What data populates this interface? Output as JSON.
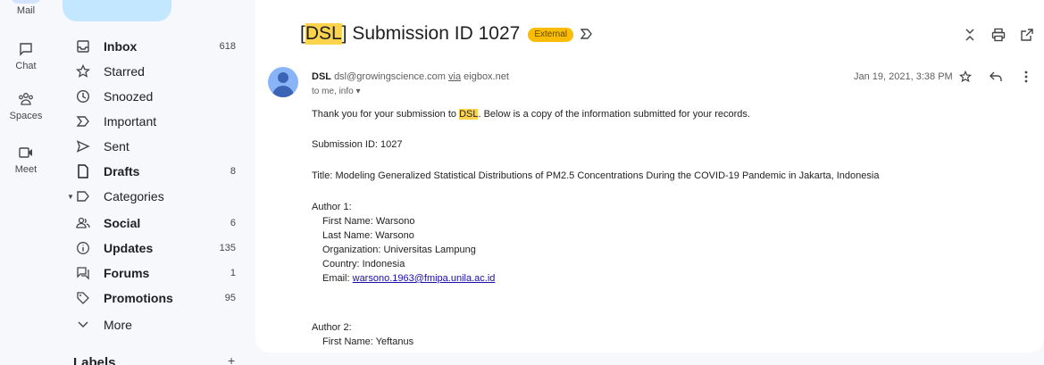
{
  "rail": {
    "mail": "Mail",
    "chat": "Chat",
    "spaces": "Spaces",
    "meet": "Meet"
  },
  "nav": {
    "inbox": {
      "label": "Inbox",
      "count": "618"
    },
    "starred": {
      "label": "Starred"
    },
    "snoozed": {
      "label": "Snoozed"
    },
    "important": {
      "label": "Important"
    },
    "sent": {
      "label": "Sent"
    },
    "drafts": {
      "label": "Drafts",
      "count": "8"
    },
    "categories": {
      "label": "Categories"
    },
    "social": {
      "label": "Social",
      "count": "6"
    },
    "updates": {
      "label": "Updates",
      "count": "135"
    },
    "forums": {
      "label": "Forums",
      "count": "1"
    },
    "promotions": {
      "label": "Promotions",
      "count": "95"
    },
    "more": {
      "label": "More"
    },
    "labels": "Labels",
    "labels_add": "+"
  },
  "email": {
    "subject_open": "[",
    "subject_tag": "DSL",
    "subject_rest": "] Submission ID 1027",
    "badge": "External",
    "sender_name": "DSL",
    "sender_email": "dsl@growingscience.com",
    "via_word": "via",
    "via_domain": "eigbox.net",
    "recipients": "to me, info ▾",
    "date": "Jan 19, 2021, 3:38 PM",
    "intro_pre": "Thank you for your submission to ",
    "intro_tag": "DSL",
    "intro_post": ".  Below is a copy of the information submitted for your records.",
    "submission_id": "Submission ID: 1027",
    "title": "Title: Modeling Generalized Statistical Distributions of PM2.5 Concentrations During the COVID-19 Pandemic in Jakarta, Indonesia",
    "author1_heading": "Author 1:",
    "author1_first": "First Name: Warsono",
    "author1_last": "Last Name: Warsono",
    "author1_org": "Organization: Universitas Lampung",
    "author1_country": "Country: Indonesia",
    "author1_email_label": "Email: ",
    "author1_email": "warsono.1963@fmipa.unila.ac.id",
    "author2_heading": "Author 2:",
    "author2_first": "First Name: Yeftanus"
  }
}
